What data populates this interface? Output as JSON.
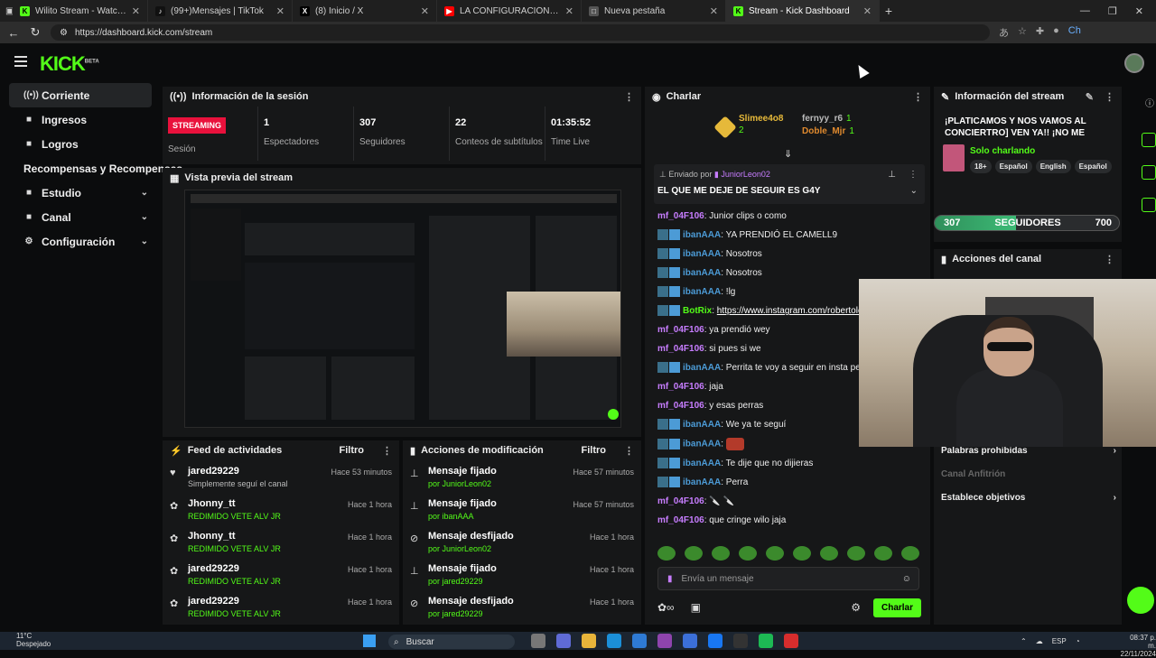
{
  "browser": {
    "tabs": [
      {
        "title": "Wilito Stream - Watch Live on Kick",
        "fav": "#53fc18",
        "glyph": "K"
      },
      {
        "title": "(99+)Mensajes | TikTok",
        "fav": "#111111",
        "glyph": "♪"
      },
      {
        "title": "(8) Inicio / X",
        "fav": "#000000",
        "glyph": "X"
      },
      {
        "title": "LA CONFIGURACIÓN MÁS FÁCIL...",
        "fav": "#ff0000",
        "glyph": "▶"
      },
      {
        "title": "Nueva pestaña",
        "fav": "#555555",
        "glyph": "□"
      },
      {
        "title": "Stream - Kick Dashboard",
        "fav": "#53fc18",
        "glyph": "K"
      }
    ],
    "url": "https://dashboard.kick.com/stream",
    "profile_label": "Ch"
  },
  "app": {
    "logo": "KICK",
    "logo_sup": "BETA"
  },
  "sidebar": {
    "items": [
      {
        "label": "Corriente",
        "icon": "((•))",
        "active": true,
        "chev": false
      },
      {
        "label": "Ingresos",
        "icon": "■",
        "active": false,
        "chev": false
      },
      {
        "label": "Logros",
        "icon": "■",
        "active": false,
        "chev": false
      },
      {
        "label": "Recompensas y Recompensas",
        "icon": "",
        "active": false,
        "chev": false
      },
      {
        "label": "Estudio",
        "icon": "■",
        "active": false,
        "chev": true
      },
      {
        "label": "Canal",
        "icon": "■",
        "active": false,
        "chev": true
      },
      {
        "label": "Configuración",
        "icon": "⚙",
        "active": false,
        "chev": true
      }
    ]
  },
  "session": {
    "title": "Información de la sesión",
    "badge": "STREAMING",
    "stats": [
      {
        "value": "",
        "label": "Sesión"
      },
      {
        "value": "1",
        "label": "Espectadores"
      },
      {
        "value": "307",
        "label": "Seguidores"
      },
      {
        "value": "22",
        "label": "Conteos de subtítulos"
      },
      {
        "value": "01:35:52",
        "label": "Time Live"
      }
    ]
  },
  "preview": {
    "title": "Vista previa del stream"
  },
  "feed": {
    "title": "Feed de actividades",
    "filter": "Filtro",
    "rows": [
      {
        "name": "jared29229",
        "sub": "Simplemente seguí el canal",
        "time": "Hace 53 minutos",
        "subcolor": "grey",
        "icon": "♥"
      },
      {
        "name": "Jhonny_tt",
        "sub": "REDIMIDO VETE ALV JR",
        "time": "Hace 1 hora",
        "subcolor": "green",
        "icon": "✿"
      },
      {
        "name": "Jhonny_tt",
        "sub": "REDIMIDO VETE ALV JR",
        "time": "Hace 1 hora",
        "subcolor": "green",
        "icon": "✿"
      },
      {
        "name": "jared29229",
        "sub": "REDIMIDO VETE ALV JR",
        "time": "Hace 1 hora",
        "subcolor": "green",
        "icon": "✿"
      },
      {
        "name": "jared29229",
        "sub": "REDIMIDO VETE ALV JR",
        "time": "Hace 1 hora",
        "subcolor": "green",
        "icon": "✿"
      }
    ]
  },
  "mods": {
    "title": "Acciones de modificación",
    "filter": "Filtro",
    "rows": [
      {
        "name": "Mensaje fijado",
        "sub": "por JuniorLeon02",
        "time": "Hace 57 minutos",
        "icon": "⊥"
      },
      {
        "name": "Mensaje fijado",
        "sub": "por ibanAAA",
        "time": "Hace 57 minutos",
        "icon": "⊥"
      },
      {
        "name": "Mensaje desfijado",
        "sub": "por JuniorLeon02",
        "time": "Hace 1 hora",
        "icon": "⊘"
      },
      {
        "name": "Mensaje fijado",
        "sub": "por jared29229",
        "time": "Hace 1 hora",
        "icon": "⊥"
      },
      {
        "name": "Mensaje desfijado",
        "sub": "por jared29229",
        "time": "Hace 1 hora",
        "icon": "⊘"
      }
    ]
  },
  "chat": {
    "title": "Charlar",
    "top_users": [
      {
        "name": "Slimee4o8",
        "count": "2",
        "color": "#e6b93a"
      },
      {
        "name": "fernyy_r6",
        "count": "1",
        "color": "#bbbbbb"
      },
      {
        "name": "Doble_Mjr",
        "count": "1",
        "color": "#e08a2e"
      }
    ],
    "pinned": {
      "label": "Enviado por",
      "user": "JuniorLeon02",
      "text": "EL QUE ME DEJE DE SEGUIR ES G4Y"
    },
    "messages": [
      {
        "user": "mf_04F106",
        "text": "Junior clips o como",
        "color": "#c77dff",
        "badges": false
      },
      {
        "user": "ibanAAA",
        "text": "YA PRENDIÓ EL CAMELL9",
        "color": "#4c9bd6",
        "badges": true
      },
      {
        "user": "ibanAAA",
        "text": "Nosotros",
        "color": "#4c9bd6",
        "badges": true
      },
      {
        "user": "ibanAAA",
        "text": "Nosotros",
        "color": "#4c9bd6",
        "badges": true
      },
      {
        "user": "ibanAAA",
        "text": "!lg",
        "color": "#4c9bd6",
        "badges": true
      },
      {
        "user": "BotRix",
        "text": "",
        "link": "https://www.instagram.com/robertoleo",
        "color": "#53fc18",
        "badges": true
      },
      {
        "user": "mf_04F106",
        "text": "ya prendió wey",
        "color": "#c77dff",
        "badges": false
      },
      {
        "user": "mf_04F106",
        "text": "si pues si we",
        "color": "#c77dff",
        "badges": false
      },
      {
        "user": "ibanAAA",
        "text": "Perrita te voy a seguir en insta pero cuenta",
        "color": "#4c9bd6",
        "badges": true
      },
      {
        "user": "mf_04F106",
        "text": "jaja",
        "color": "#c77dff",
        "badges": false
      },
      {
        "user": "mf_04F106",
        "text": "y esas perras",
        "color": "#c77dff",
        "badges": false
      },
      {
        "user": "ibanAAA",
        "text": "We ya te seguí",
        "color": "#4c9bd6",
        "badges": true
      },
      {
        "user": "ibanAAA",
        "text": "",
        "color": "#4c9bd6",
        "badges": true,
        "emote": true
      },
      {
        "user": "ibanAAA",
        "text": "Te dije que no dijieras",
        "color": "#4c9bd6",
        "badges": true
      },
      {
        "user": "ibanAAA",
        "text": "Perra",
        "color": "#4c9bd6",
        "badges": true
      },
      {
        "user": "mf_04F106",
        "text": "🔪 🔪",
        "color": "#c77dff",
        "badges": false
      },
      {
        "user": "mf_04F106",
        "text": "que cringe wilo jaja",
        "color": "#c77dff",
        "badges": false
      }
    ],
    "input_placeholder": "Envía un mensaje",
    "send_label": "Charlar"
  },
  "stream_info": {
    "title": "Información del stream",
    "headline": "¡PLATICAMOS Y NOS VAMOS AL CONCIERTRO] VEN YA!! ¡NO ME DEJEN...",
    "category": "Solo charlando",
    "tags": [
      "18+",
      "Español",
      "English",
      "Español"
    ],
    "followers_current": "307",
    "followers_label": "SEGUIDORES",
    "followers_goal": "700",
    "followers_progress": 0.44
  },
  "channel": {
    "title": "Acciones del canal",
    "items": [
      {
        "label": "Palabras prohibidas",
        "enabled": true
      },
      {
        "label": "Canal Anfitrión",
        "enabled": false
      },
      {
        "label": "Establece objetivos",
        "enabled": true
      }
    ]
  },
  "taskbar": {
    "temp": "11°C",
    "weather": "Despejado",
    "search": "Buscar",
    "lang": "ESP",
    "time": "08:37 p. m.",
    "date": "22/11/2024"
  }
}
